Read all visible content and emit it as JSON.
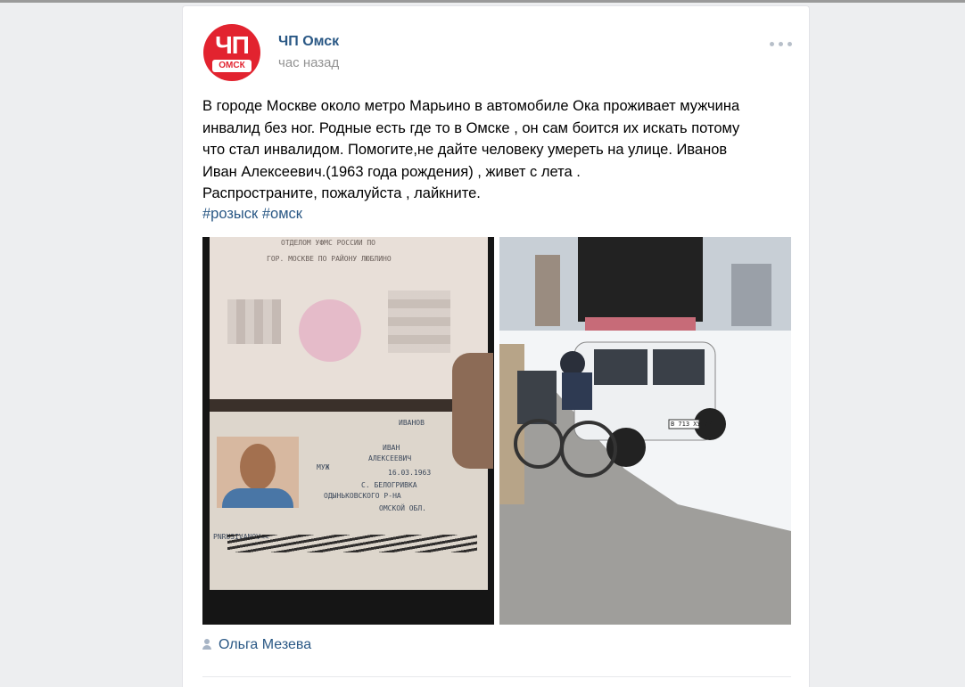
{
  "post": {
    "author": "ЧП Омск",
    "time": "час назад",
    "avatar": {
      "big": "ЧП",
      "small": "ОМСК"
    },
    "text_lines": [
      "В городе Москве около метро Марьино в автомобиле Ока проживает мужчина",
      "инвалид без ног. Родные есть где то в Омске , он сам боится их искать потому",
      "что стал инвалидом. Помогите,не дайте человеку умереть на улице. Иванов",
      "Иван Алексеевич.(1963 года рождения) , живет с лета .",
      "Распространите, пожалуйста , лайкните."
    ],
    "hashtags": [
      "#розыск",
      "#омск"
    ],
    "signer": "Ольга Мезева",
    "more_icon": "more-dots-icon",
    "signer_icon": "user-icon"
  },
  "photos": {
    "passport": {
      "header_line1": "ОТДЕЛОМ УФМС РОССИИ ПО",
      "header_line2": "ГОР. МОСКВЕ ПО РАЙОНУ ЛЮБЛИНО",
      "surname": "ИВАНОВ",
      "name": "ИВАН",
      "patronymic": "АЛЕКСЕЕВИЧ",
      "sex": "МУЖ",
      "birth_date": "16.03.1963",
      "birth_place_1": "С. БЕЛОГРИВКА",
      "birth_place_2": "ОДЫНЬКОВСКОГО Р-НА",
      "birth_place_3": "ОМСКОЙ ОБЛ.",
      "mrz": "PNRUSIVANOV<<"
    },
    "street": {
      "plate": "В 713 ХУ 77"
    }
  },
  "colors": {
    "link": "#2a5885",
    "brand_red": "#e2232f",
    "muted": "#939393"
  }
}
